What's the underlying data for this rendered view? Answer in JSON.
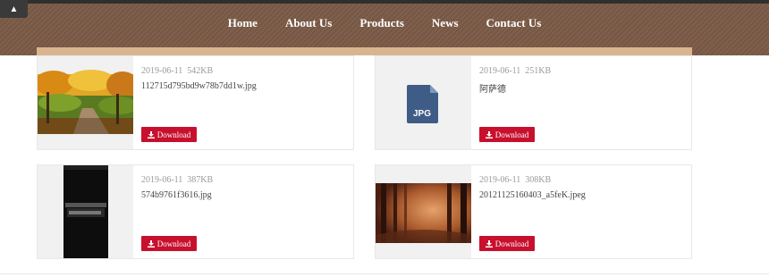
{
  "nav": {
    "scroll_top_glyph": "▲",
    "items": [
      {
        "label": "Home"
      },
      {
        "label": "About Us"
      },
      {
        "label": "Products"
      },
      {
        "label": "News"
      },
      {
        "label": "Contact Us"
      }
    ]
  },
  "files": [
    {
      "date": "2019-06-11",
      "size": "542KB",
      "name": "112715d795bd9w78b7dd1w.jpg",
      "download_label": "Download",
      "thumbnail": "autumn-park-photo"
    },
    {
      "date": "2019-06-11",
      "size": "251KB",
      "name": "阿萨德",
      "download_label": "Download",
      "thumbnail": "jpg-file-icon",
      "icon_text": "JPG"
    },
    {
      "date": "2019-06-11",
      "size": "387KB",
      "name": "574b9761f3616.jpg",
      "download_label": "Download",
      "thumbnail": "phone-screenshot"
    },
    {
      "date": "2019-06-11",
      "size": "308KB",
      "name": "20121125160403_a5feK.jpeg",
      "download_label": "Download",
      "thumbnail": "misty-forest-photo"
    }
  ],
  "colors": {
    "header_bg": "#7a5a47",
    "accent_strip": "#d9b58f",
    "download_button": "#c8102e",
    "jpg_icon": "#3f5c86"
  }
}
